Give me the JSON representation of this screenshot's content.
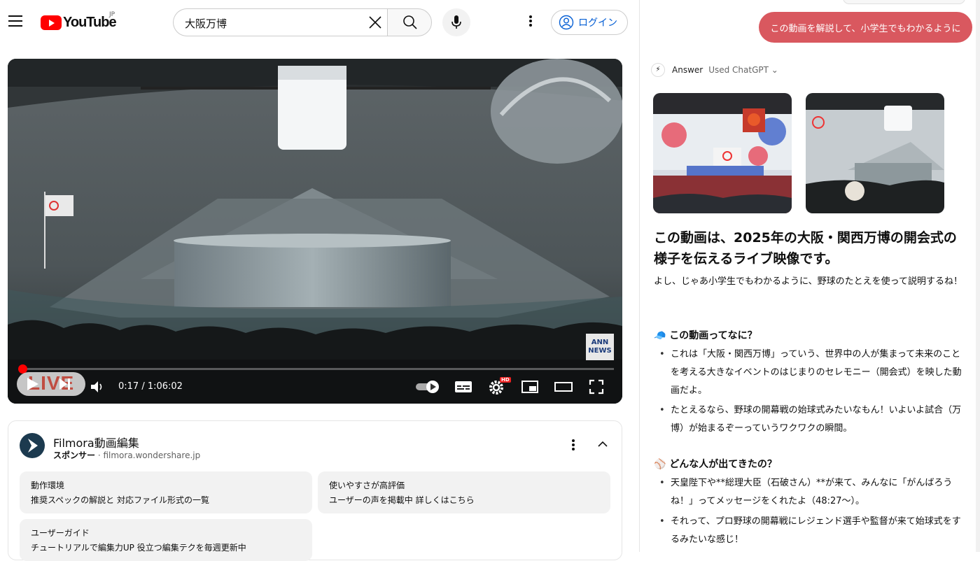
{
  "header": {
    "logo_text": "YouTube",
    "region": "JP",
    "search_value": "大阪万博",
    "login_label": "ログイン"
  },
  "player": {
    "time": "0:17 / 1:06:02",
    "live_label": "LIVE",
    "hd_badge": "HD",
    "broadcaster_logo": "ANN NEWS",
    "progress": 0.004
  },
  "sponsor": {
    "title": "Filmora動画編集",
    "sponsor_label": "スポンサー",
    "domain": "filmora.wondershare.jp",
    "tiles": [
      {
        "title": "動作環境",
        "desc": "推奨スペックの解説と 対応ファイル形式の一覧"
      },
      {
        "title": "使いやすさが高評価",
        "desc": "ユーザーの声を掲載中 詳しくはこちら"
      },
      {
        "title": "ユーザーガイド",
        "desc": "チュートリアルで編集力UP 役立つ編集テクを毎週更新中"
      }
    ]
  },
  "chat": {
    "user_message": "この動画を解説して、小学生でもわかるように",
    "answer_label": "Answer",
    "used_label": "Used ChatGPT",
    "headline": "この動画は、2025年の大阪・関西万博の開会式の様子を伝えるライブ映像です。",
    "intro": "よし、じゃあ小学生でもわかるように、野球のたとえを使って説明するね！",
    "sections": [
      {
        "title": "この動画ってなに？",
        "bullets": [
          "これは「大阪・関西万博」っていう、世界中の人が集まって未来のことを考える大きなイベントのはじまりのセレモニー（開会式）を映した動画だよ。",
          "たとえるなら、野球の開幕戦の始球式みたいなもん！いよいよ試合（万博）が始まるぞーっていうワクワクの瞬間。"
        ]
      },
      {
        "title": "どんな人が出てきたの？",
        "bullets": [
          "天皇陛下や**総理大臣（石破さん）**が来て、みんなに「がんばろうね！」ってメッセージをくれたよ（48:27〜）。",
          "それって、プロ野球の開幕戦にレジェンド選手や監督が来て始球式をするみたいな感じ！"
        ]
      }
    ]
  }
}
